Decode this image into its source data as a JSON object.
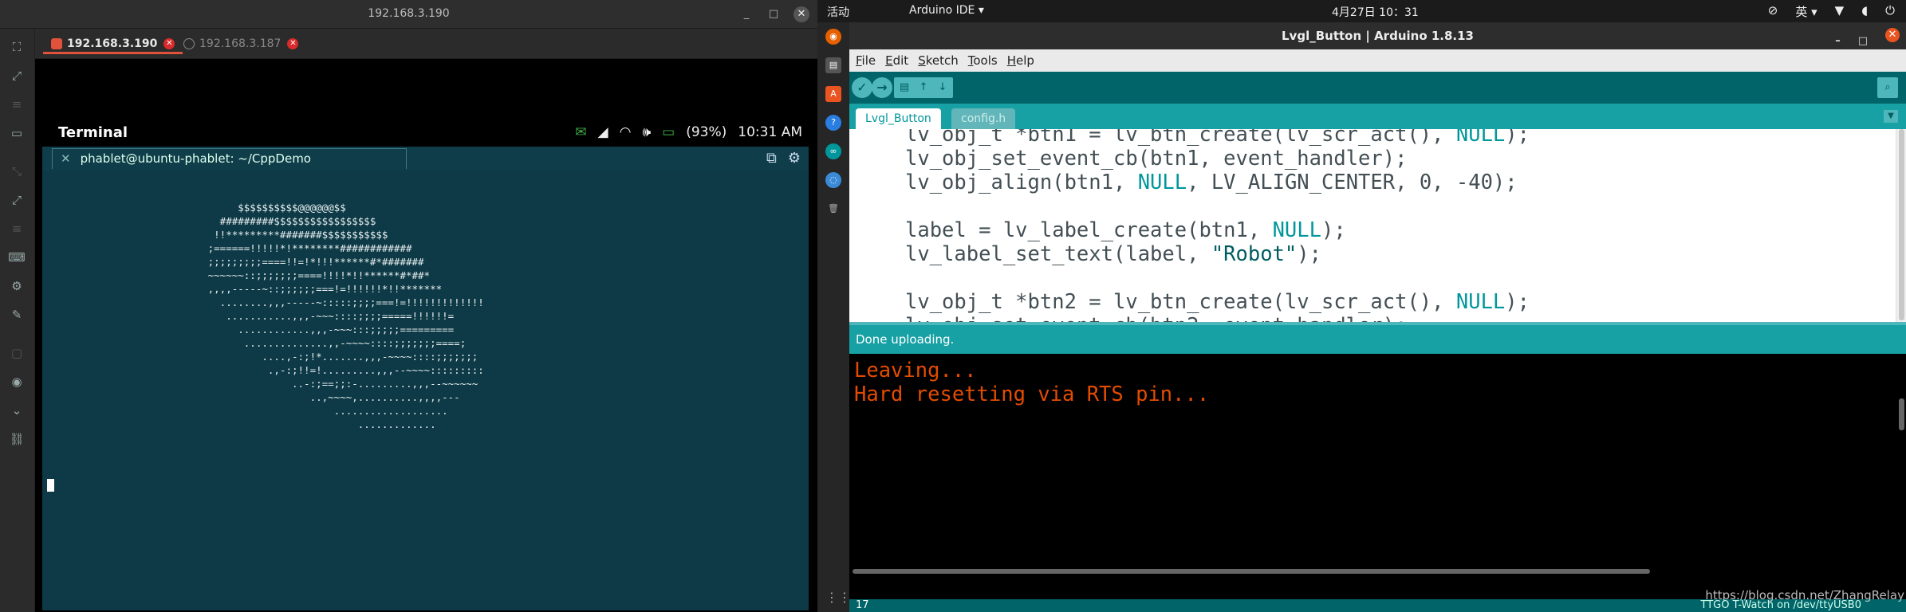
{
  "vnc": {
    "window_title": "192.168.3.190",
    "min_btn": "_",
    "max_btn": "□",
    "close_btn": "✕",
    "tabs": [
      {
        "label": "192.168.3.190"
      },
      {
        "label": "192.168.3.187"
      }
    ],
    "tab_close_glyph": "✕"
  },
  "phone": {
    "app_title": "Terminal",
    "battery_text": "(93%)",
    "time": "10:31 AM",
    "status_icons": [
      "message-icon",
      "signal-icon",
      "wifi-icon",
      "volume-icon",
      "battery-icon"
    ]
  },
  "terminal": {
    "tab_close": "✕",
    "tab_title": "phablet@ubuntu-phablet: ~/CppDemo",
    "ascii_art": "          $$$$$$$$$$@@@@@@$$\n       #########$$$$$$$$$$$$$$$$$\n      !!*********#######$$$$$$$$$$$\n     ;======!!!!!*!********############\n     ;;;;;;;;;====!!=!*!!!******#*#######\n     ~~~~~~::;;;;;;;====!!!!*!!******#*##*\n     ,,,,-----~::;;;;;;===!=!!!!!!*!!*******\n       ........,,,-----~:::::;;;;===!=!!!!!!!!!!!!!\n        ...........,,,-~~~::::;;;;=====!!!!!!=\n          ............,,,-~~~:::;;;;;=========\n           ..............,,-~~~~::::;;;;;;;====;\n              ....,-:;!*.......,,,-~~~~::::;;;;;;;\n               .,-:;!!=!.........,,,--~~~~:::::::::\n                   ..-:;==;;:-.........,,,--~~~~~~\n                      ..,~~~~,..........,,,,---\n                          ...................\n                              ............."
  },
  "desktop": {
    "activities": "活动",
    "app_menu": "Arduino IDE ▾",
    "clock": "4月27日 10：31",
    "indicators": [
      "accessibility-icon",
      "英 ▾",
      "network-icon",
      "volume-icon",
      "power-icon"
    ]
  },
  "arduino": {
    "window_title": "Lvgl_Button | Arduino 1.8.13",
    "menu": [
      "File",
      "Edit",
      "Sketch",
      "Tools",
      "Help"
    ],
    "toolbar": {
      "verify": "✓",
      "upload": "→",
      "new": "▤",
      "open": "↑",
      "save": "↓",
      "serial_monitor": "⌕"
    },
    "tabs": [
      {
        "label": "Lvgl_Button"
      },
      {
        "label": "config.h"
      }
    ],
    "tab_menu": "▼",
    "status_message": "Done uploading.",
    "console_lines": [
      "Leaving...",
      "Hard resetting via RTS pin..."
    ],
    "line_number": "17",
    "board": "TTGO T-Watch on /dev/ttyUSB0",
    "watermark": "https://blog.csdn.net/ZhangRelay"
  }
}
